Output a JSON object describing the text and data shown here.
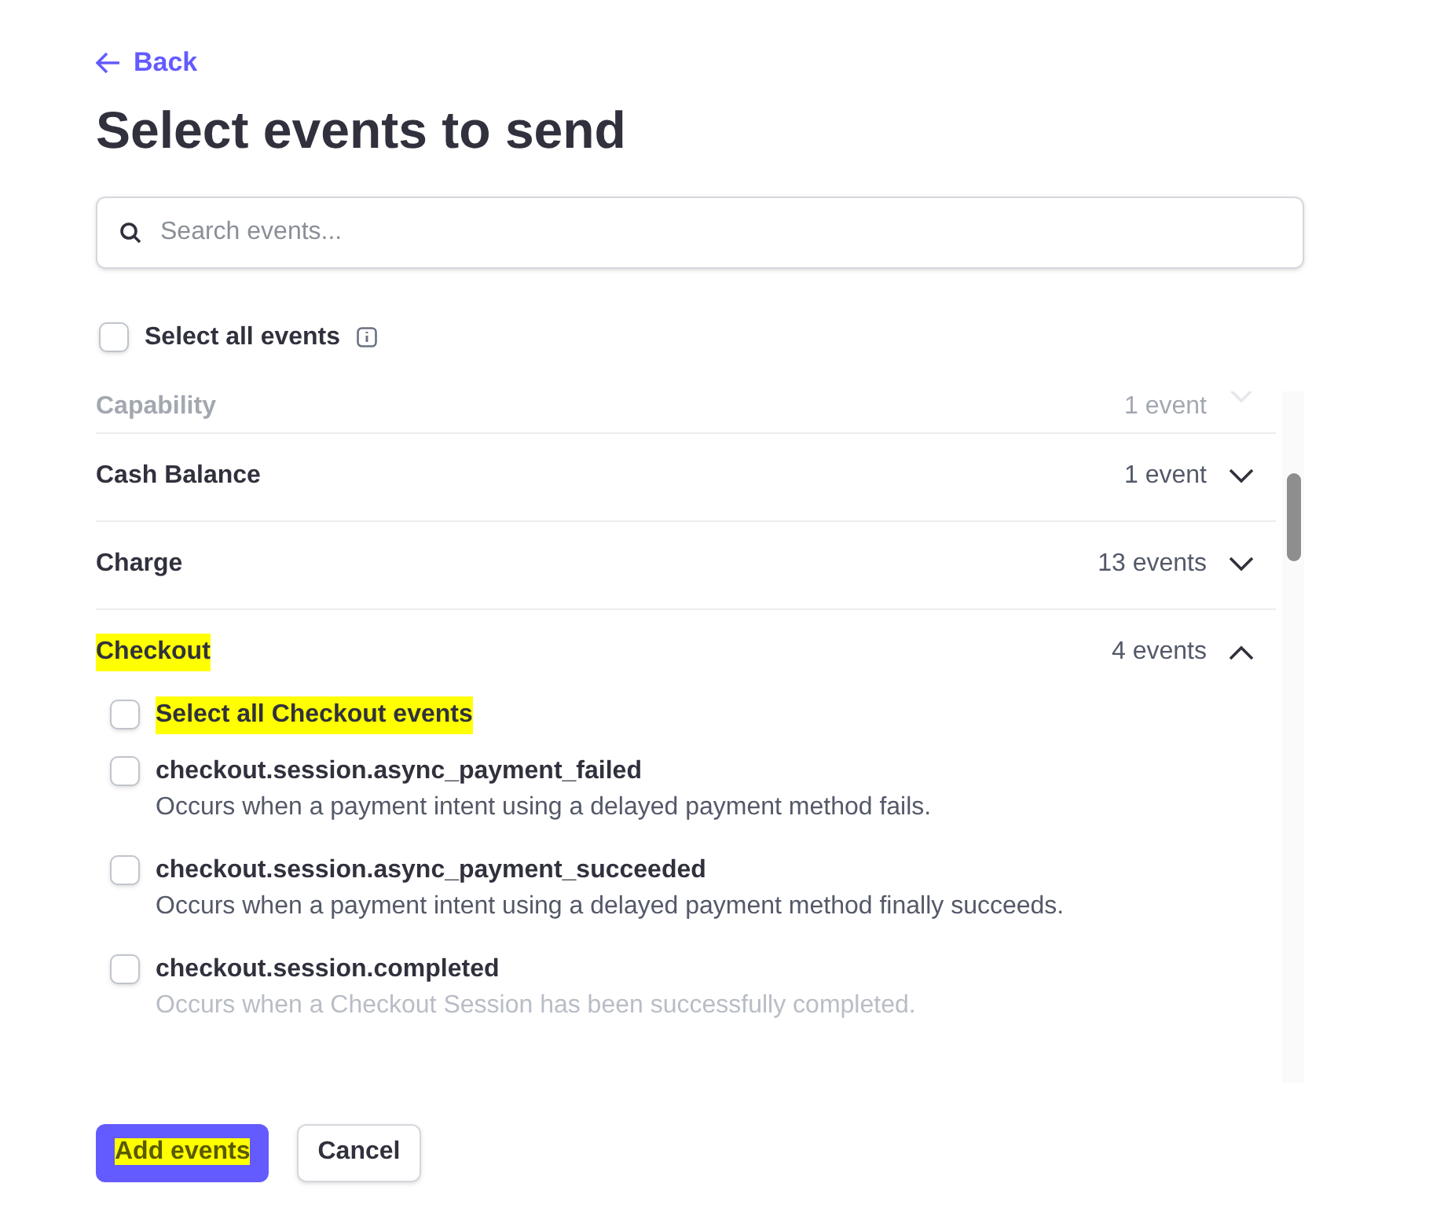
{
  "back": {
    "label": "Back"
  },
  "title": "Select events to send",
  "search": {
    "placeholder": "Search events..."
  },
  "select_all": {
    "label": "Select all events",
    "checked": false
  },
  "groups": [
    {
      "name": "Capability",
      "count": "1 event",
      "expanded": false,
      "faded": true,
      "highlighted": false
    },
    {
      "name": "Cash Balance",
      "count": "1 event",
      "expanded": false,
      "faded": false,
      "highlighted": false
    },
    {
      "name": "Charge",
      "count": "13 events",
      "expanded": false,
      "faded": false,
      "highlighted": false
    },
    {
      "name": "Checkout",
      "count": "4 events",
      "expanded": true,
      "faded": false,
      "highlighted": true,
      "select_all": {
        "label": "Select all Checkout events",
        "checked": false,
        "highlighted": true
      },
      "events": [
        {
          "name": "checkout.session.async_payment_failed",
          "description": "Occurs when a payment intent using a delayed payment method fails.",
          "checked": false,
          "faded": false
        },
        {
          "name": "checkout.session.async_payment_succeeded",
          "description": "Occurs when a payment intent using a delayed payment method finally succeeds.",
          "checked": false,
          "faded": false
        },
        {
          "name": "checkout.session.completed",
          "description": "Occurs when a Checkout Session has been successfully completed.",
          "checked": false,
          "faded": true
        }
      ]
    }
  ],
  "buttons": [
    {
      "label": "Add events",
      "kind": "primary",
      "highlighted": true
    },
    {
      "label": "Cancel",
      "kind": "secondary",
      "highlighted": false
    }
  ]
}
